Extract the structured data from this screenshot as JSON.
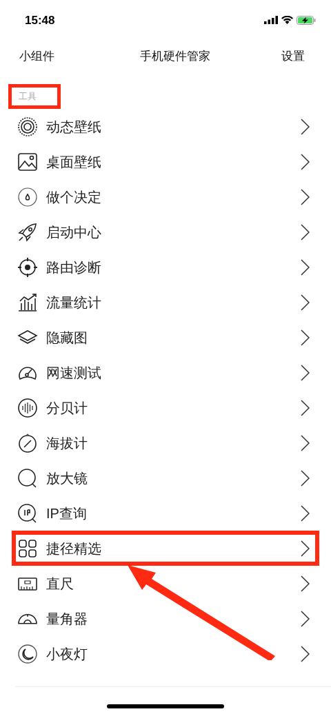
{
  "status_bar": {
    "time": "15:48"
  },
  "header": {
    "left": "小组件",
    "title": "手机硬件管家",
    "right": "设置"
  },
  "section": {
    "title": "工具",
    "highlighted": true
  },
  "items": [
    {
      "label": "动态壁纸",
      "highlighted": false
    },
    {
      "label": "桌面壁纸",
      "highlighted": false
    },
    {
      "label": "做个决定",
      "highlighted": false
    },
    {
      "label": "启动中心",
      "highlighted": false
    },
    {
      "label": "路由诊断",
      "highlighted": false
    },
    {
      "label": "流量统计",
      "highlighted": false
    },
    {
      "label": "隐藏图",
      "highlighted": false
    },
    {
      "label": "网速测试",
      "highlighted": false
    },
    {
      "label": "分贝计",
      "highlighted": false
    },
    {
      "label": "海拔计",
      "highlighted": false
    },
    {
      "label": "放大镜",
      "highlighted": false
    },
    {
      "label": "IP查询",
      "highlighted": false
    },
    {
      "label": "捷径精选",
      "highlighted": true
    },
    {
      "label": "直尺",
      "highlighted": false
    },
    {
      "label": "量角器",
      "highlighted": false
    },
    {
      "label": "小夜灯",
      "highlighted": false
    }
  ]
}
